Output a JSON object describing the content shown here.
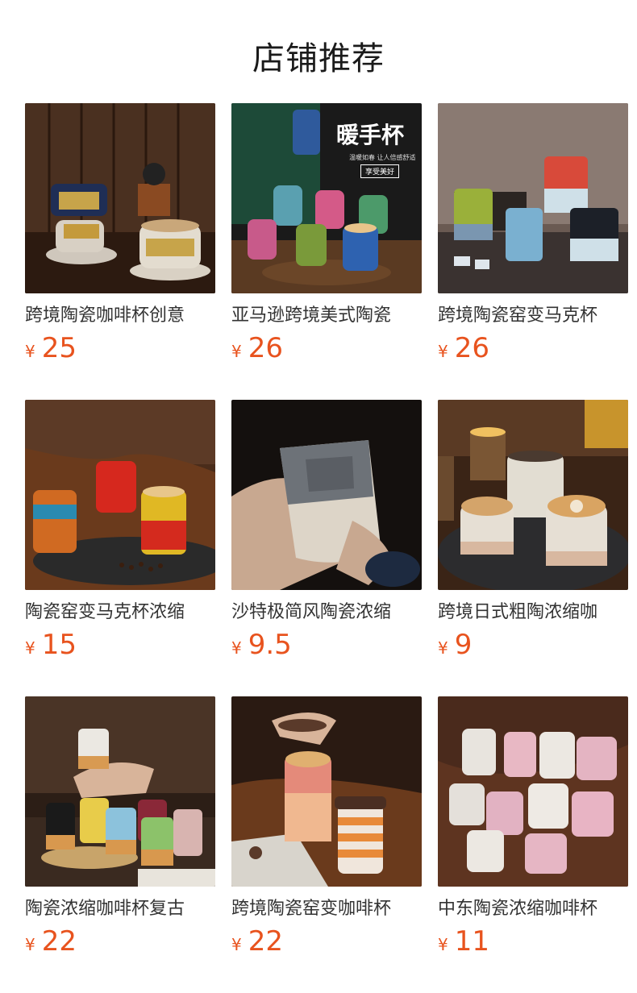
{
  "title": "店铺推荐",
  "currency_symbol": "¥",
  "products": [
    {
      "name": "跨境陶瓷咖啡杯创意",
      "price": "25",
      "image": "gold-band-cups-icon"
    },
    {
      "name": "亚马逊跨境美式陶瓷",
      "price": "26",
      "image": "warm-hand-cups-icon",
      "image_text": [
        "暖手杯",
        "温暖如春 让人倍感舒适",
        "享受美好"
      ]
    },
    {
      "name": "跨境陶瓷窑变马克杯",
      "price": "26",
      "image": "glaze-mugs-icon"
    },
    {
      "name": "陶瓷窑变马克杯浓缩",
      "price": "15",
      "image": "red-yellow-mugs-icon"
    },
    {
      "name": "沙特极简风陶瓷浓缩",
      "price": "9.5",
      "image": "embossed-cup-icon"
    },
    {
      "name": "跨境日式粗陶浓缩咖",
      "price": "9",
      "image": "latte-cups-icon"
    },
    {
      "name": "陶瓷浓缩咖啡杯复古",
      "price": "22",
      "image": "colorful-cups-icon"
    },
    {
      "name": "跨境陶瓷窑变咖啡杯",
      "price": "22",
      "image": "lidded-cups-icon"
    },
    {
      "name": "中东陶瓷浓缩咖啡杯",
      "price": "11",
      "image": "pink-white-cups-icon"
    }
  ],
  "colors": {
    "price": "#e8531e",
    "text": "#333333"
  }
}
